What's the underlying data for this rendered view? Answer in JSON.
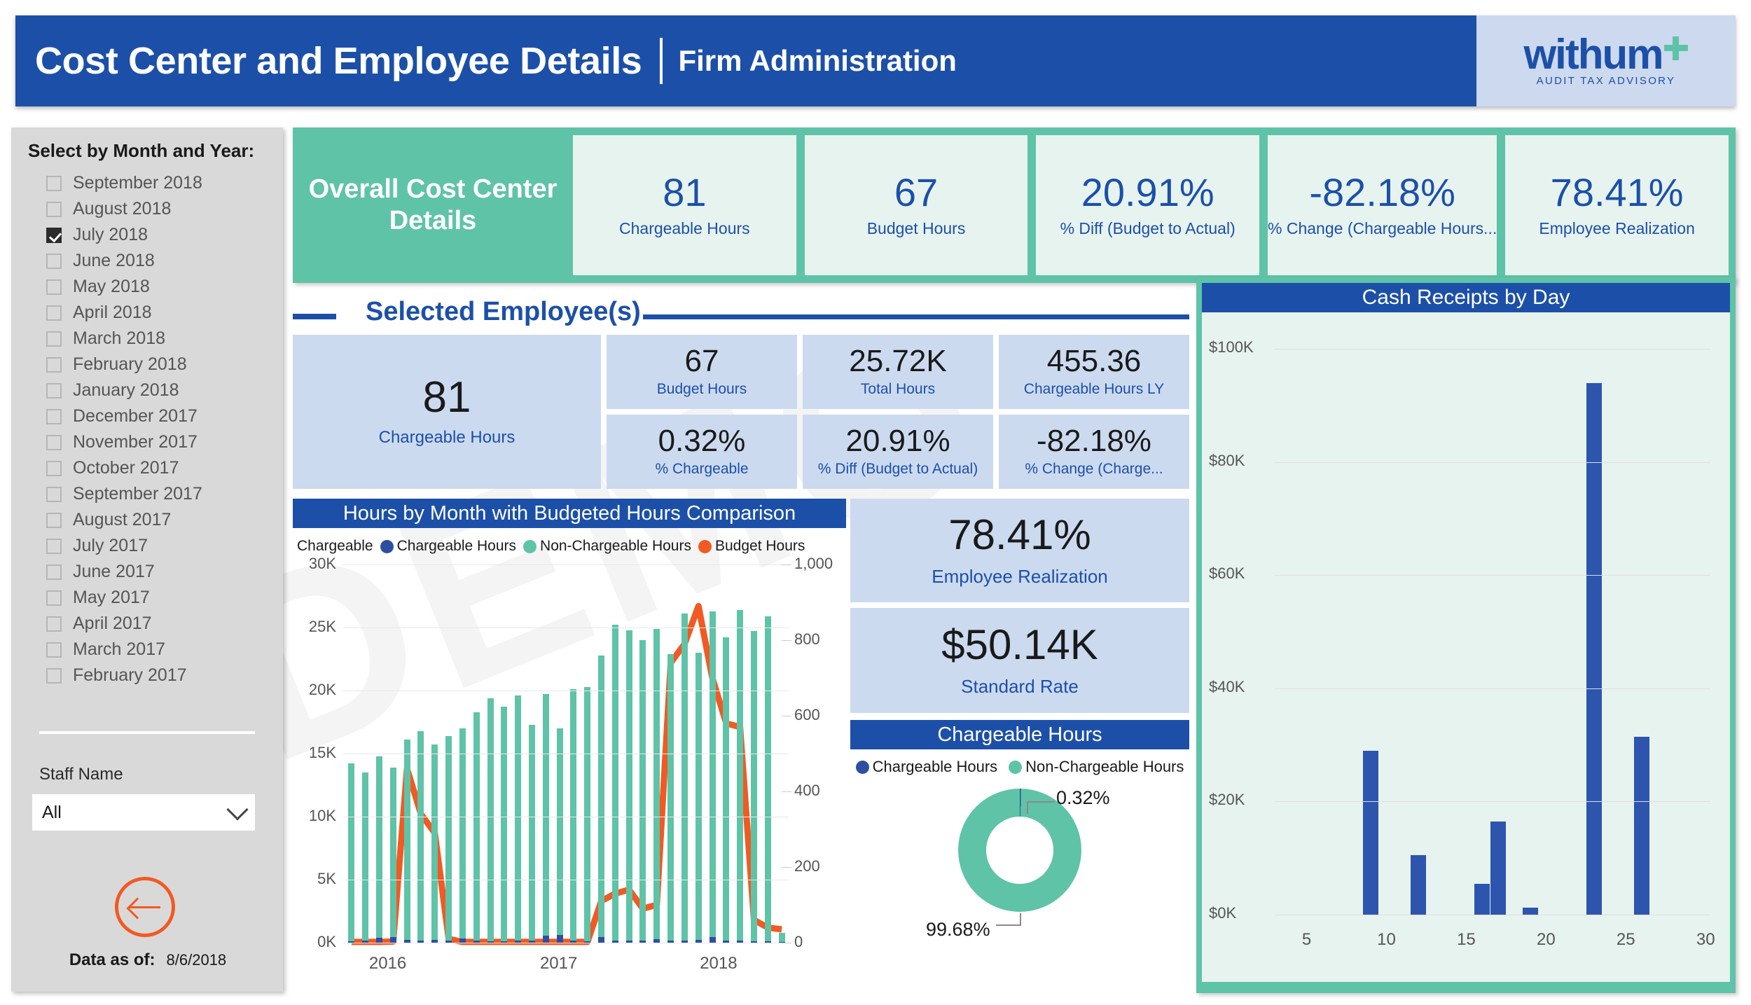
{
  "header": {
    "title": "Cost Center and Employee Details",
    "subtitle": "Firm Administration",
    "logo_word": "withum",
    "logo_tagline": "AUDIT  TAX  ADVISORY"
  },
  "sidebar": {
    "slicer_title": "Select by Month and Year:",
    "months": [
      {
        "label": "September 2018",
        "checked": false
      },
      {
        "label": "August 2018",
        "checked": false
      },
      {
        "label": "July 2018",
        "checked": true
      },
      {
        "label": "June 2018",
        "checked": false
      },
      {
        "label": "May 2018",
        "checked": false
      },
      {
        "label": "April 2018",
        "checked": false
      },
      {
        "label": "March 2018",
        "checked": false
      },
      {
        "label": "February 2018",
        "checked": false
      },
      {
        "label": "January 2018",
        "checked": false
      },
      {
        "label": "December 2017",
        "checked": false
      },
      {
        "label": "November 2017",
        "checked": false
      },
      {
        "label": "October 2017",
        "checked": false
      },
      {
        "label": "September 2017",
        "checked": false
      },
      {
        "label": "August 2017",
        "checked": false
      },
      {
        "label": "July 2017",
        "checked": false
      },
      {
        "label": "June 2017",
        "checked": false
      },
      {
        "label": "May 2017",
        "checked": false
      },
      {
        "label": "April 2017",
        "checked": false
      },
      {
        "label": "March 2017",
        "checked": false
      },
      {
        "label": "February 2017",
        "checked": false
      }
    ],
    "staff_label": "Staff Name",
    "staff_value": "All",
    "data_as_of_label": "Data as of:",
    "data_as_of_value": "8/6/2018"
  },
  "overall": {
    "label": "Overall Cost Center Details",
    "cards": [
      {
        "value": "81",
        "label": "Chargeable Hours"
      },
      {
        "value": "67",
        "label": "Budget Hours"
      },
      {
        "value": "20.91%",
        "label": "% Diff (Budget to Actual)"
      },
      {
        "value": "-82.18%",
        "label": "% Change (Chargeable Hours..."
      },
      {
        "value": "78.41%",
        "label": "Employee Realization"
      }
    ]
  },
  "selected_employees": {
    "section_title": "Selected Employee(s)",
    "primary": {
      "value": "81",
      "label": "Chargeable Hours"
    },
    "cards": [
      {
        "value": "67",
        "label": "Budget Hours"
      },
      {
        "value": "25.72K",
        "label": "Total Hours"
      },
      {
        "value": "455.36",
        "label": "Chargeable Hours LY"
      },
      {
        "value": "0.32%",
        "label": "% Chargeable"
      },
      {
        "value": "20.91%",
        "label": "% Diff (Budget to Actual)"
      },
      {
        "value": "-82.18%",
        "label": "% Change (Charge..."
      }
    ]
  },
  "mid_kpis": [
    {
      "value": "78.41%",
      "label": "Employee Realization"
    },
    {
      "value": "$50.14K",
      "label": "Standard Rate"
    }
  ],
  "watermark": "DEMO",
  "colors": {
    "brand_blue": "#1c50a8",
    "brand_teal": "#5fc3a8",
    "orange": "#f15a22",
    "bar_blue": "#2d4fa2",
    "card_blue": "#ccdaf0",
    "card_teal": "#e7f3ef"
  },
  "chart_data": [
    {
      "type": "bar",
      "name": "hours-by-month",
      "title": "Hours by Month with Budgeted Hours Comparison",
      "legend_prefix": "Chargeable",
      "legend": [
        "Chargeable Hours",
        "Non-Chargeable Hours",
        "Budget Hours"
      ],
      "legend_colors": [
        "#2d4fa2",
        "#5fc3a8",
        "#f15a22"
      ],
      "legend_position": "top",
      "grid": true,
      "xlabel": "",
      "ylabel": "",
      "ylim": [
        0,
        30000
      ],
      "ytick_labels": [
        "0K",
        "5K",
        "10K",
        "15K",
        "20K",
        "25K",
        "30K"
      ],
      "y2lim": [
        0,
        1000
      ],
      "y2tick_labels": [
        "0",
        "200",
        "400",
        "600",
        "800",
        "1,000"
      ],
      "x_tick_labels": [
        "2016",
        "2017",
        "2018"
      ],
      "categories": [
        "2016-01",
        "2016-02",
        "2016-03",
        "2016-04",
        "2016-05",
        "2016-06",
        "2016-07",
        "2016-08",
        "2016-09",
        "2016-10",
        "2016-11",
        "2016-12",
        "2017-01",
        "2017-02",
        "2017-03",
        "2017-04",
        "2017-05",
        "2017-06",
        "2017-07",
        "2017-08",
        "2017-09",
        "2017-10",
        "2017-11",
        "2017-12",
        "2018-01",
        "2018-02",
        "2018-03",
        "2018-04",
        "2018-05",
        "2018-06",
        "2018-07",
        "2018-08"
      ],
      "series": [
        {
          "name": "Non-Chargeable Hours",
          "color": "#5fc3a8",
          "axis": "left",
          "values": [
            14200,
            13500,
            14800,
            13900,
            16100,
            16800,
            15700,
            16400,
            17000,
            18300,
            19400,
            18700,
            19600,
            17300,
            19700,
            17000,
            20100,
            20300,
            22800,
            25200,
            24800,
            24000,
            24900,
            22900,
            26100,
            23000,
            26300,
            24200,
            26400,
            24700,
            25900,
            800
          ]
        },
        {
          "name": "Chargeable Hours",
          "color": "#2d4fa2",
          "axis": "left",
          "values": [
            120,
            150,
            380,
            470,
            220,
            180,
            200,
            170,
            330,
            150,
            120,
            110,
            160,
            150,
            580,
            620,
            140,
            130,
            420,
            150,
            160,
            140,
            300,
            160,
            180,
            250,
            430,
            160,
            140,
            120,
            130,
            0
          ]
        },
        {
          "name": "Budget Hours",
          "color": "#f15a22",
          "axis": "right",
          "render": "line",
          "values": [
            2,
            2,
            2,
            3,
            460,
            340,
            290,
            10,
            2,
            2,
            2,
            2,
            2,
            2,
            2,
            2,
            2,
            2,
            110,
            130,
            140,
            90,
            100,
            740,
            790,
            890,
            700,
            580,
            570,
            60,
            40,
            35
          ]
        }
      ]
    },
    {
      "type": "pie",
      "name": "chargeable-hours-donut",
      "title": "Chargeable Hours",
      "legend": [
        "Chargeable Hours",
        "Non-Chargeable Hours"
      ],
      "legend_colors": [
        "#2d4fa2",
        "#5fc3a8"
      ],
      "legend_position": "top",
      "labels": [
        "Chargeable Hours",
        "Non-Chargeable Hours"
      ],
      "values": [
        0.32,
        99.68
      ],
      "value_labels": [
        "0.32%",
        "99.68%"
      ]
    },
    {
      "type": "bar",
      "name": "cash-receipts-by-day",
      "title": "Cash Receipts by Day",
      "grid": true,
      "xlabel": "",
      "ylabel": "",
      "ylim": [
        0,
        105000
      ],
      "ytick_labels": [
        "$0K",
        "$20K",
        "$40K",
        "$60K",
        "$80K",
        "$100K"
      ],
      "ytick_values": [
        0,
        20000,
        40000,
        60000,
        80000,
        100000
      ],
      "x_tick_labels": [
        "5",
        "10",
        "15",
        "20",
        "25",
        "30"
      ],
      "x_tick_values": [
        5,
        10,
        15,
        20,
        25,
        30
      ],
      "bar_color": "#2d55ae",
      "categories": [
        9,
        12,
        16,
        17,
        19,
        23,
        26
      ],
      "values": [
        29000,
        10500,
        5500,
        16500,
        1200,
        94000,
        31500
      ]
    }
  ]
}
